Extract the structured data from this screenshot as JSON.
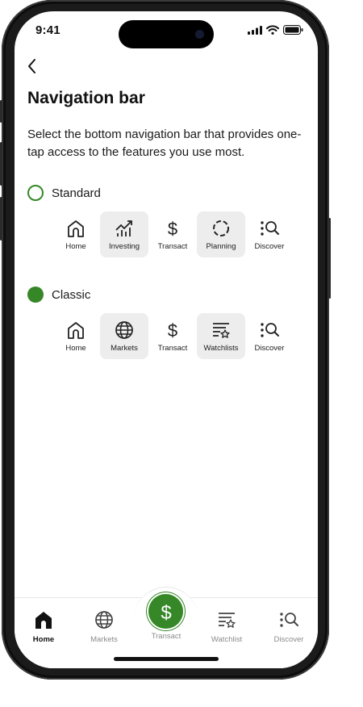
{
  "status": {
    "time": "9:41"
  },
  "page": {
    "title": "Navigation bar",
    "description": "Select the bottom navigation bar that provides one-tap access to the features you use most."
  },
  "options": [
    {
      "label": "Standard",
      "selected": false,
      "items": [
        {
          "label": "Home",
          "icon": "home-icon",
          "highlighted": false
        },
        {
          "label": "Investing",
          "icon": "investing-icon",
          "highlighted": true
        },
        {
          "label": "Transact",
          "icon": "dollar-icon",
          "highlighted": false
        },
        {
          "label": "Planning",
          "icon": "planning-icon",
          "highlighted": true
        },
        {
          "label": "Discover",
          "icon": "discover-icon",
          "highlighted": false
        }
      ]
    },
    {
      "label": "Classic",
      "selected": true,
      "items": [
        {
          "label": "Home",
          "icon": "home-icon",
          "highlighted": false
        },
        {
          "label": "Markets",
          "icon": "globe-icon",
          "highlighted": true
        },
        {
          "label": "Transact",
          "icon": "dollar-icon",
          "highlighted": false
        },
        {
          "label": "Watchlists",
          "icon": "watchlist-icon",
          "highlighted": true
        },
        {
          "label": "Discover",
          "icon": "discover-icon",
          "highlighted": false
        }
      ]
    }
  ],
  "tabbar": {
    "items": [
      {
        "label": "Home",
        "icon": "home-filled-icon",
        "active": true
      },
      {
        "label": "Markets",
        "icon": "globe-icon",
        "active": false
      },
      {
        "label": "Transact",
        "icon": "dollar-circle-icon",
        "active": false
      },
      {
        "label": "Watchlist",
        "icon": "watchlist-icon",
        "active": false
      },
      {
        "label": "Discover",
        "icon": "discover-icon",
        "active": false
      }
    ]
  },
  "colors": {
    "accent": "#368727",
    "highlight": "#ededed",
    "muted": "#8a8a8a"
  }
}
